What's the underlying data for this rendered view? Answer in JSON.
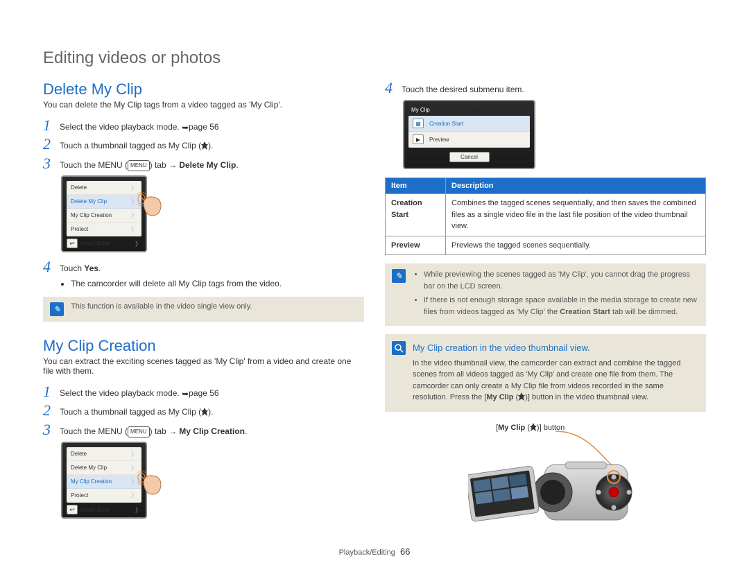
{
  "page_title": "Editing videos or photos",
  "left": {
    "delete": {
      "heading": "Delete My Clip",
      "intro": "You can delete the My Clip tags from a video tagged as 'My Clip'.",
      "steps": {
        "s1": "Select the video playback mode. ",
        "s1_ref": "page 56",
        "s2_pre": "Touch a thumbnail tagged as My Clip (",
        "s2_post": ").",
        "s3_pre": "Touch the MENU (",
        "s3_mid": ") tab → ",
        "s3_bold": "Delete My Clip",
        "s3_post": ".",
        "s4_pre": "Touch ",
        "s4_bold": "Yes",
        "s4_post": ".",
        "s4_sub": "The camcorder will delete all My Clip tags from the video."
      },
      "menu_badge": "MENU",
      "screenshot": {
        "items": [
          "Delete",
          "Delete My Clip",
          "My Clip Creation",
          "Protect",
          "Smart BGM"
        ],
        "highlight_index": 1
      },
      "note": "This function is available in the video single view only."
    },
    "creation": {
      "heading": "My Clip Creation",
      "intro": "You can extract the exciting scenes tagged as 'My Clip' from a video and create one file with them.",
      "steps": {
        "s1": "Select the video playback mode. ",
        "s1_ref": "page 56",
        "s2_pre": "Touch a thumbnail tagged as My Clip (",
        "s2_post": ").",
        "s3_pre": "Touch the MENU (",
        "s3_mid": ") tab → ",
        "s3_bold": "My Clip Creation",
        "s3_post": "."
      },
      "screenshot": {
        "items": [
          "Delete",
          "Delete My Clip",
          "My Clip Creation",
          "Protect",
          "Smart BGM"
        ],
        "highlight_index": 2
      }
    }
  },
  "right": {
    "step4": "Touch the desired submenu item.",
    "submenu": {
      "title": "My Clip",
      "row1": "Creation Start",
      "row2": "Preview",
      "cancel": "Cancel"
    },
    "table": {
      "h_item": "Item",
      "h_desc": "Description",
      "r1_item": "Creation Start",
      "r1_desc": "Combines the tagged scenes sequentially, and then saves the combined files as a single video file in the last file position of the video thumbnail view.",
      "r2_item": "Preview",
      "r2_desc": "Previews the tagged scenes sequentially."
    },
    "note": {
      "b1": "While previewing the scenes tagged as 'My Clip', you cannot drag the progress bar on the LCD screen.",
      "b2_pre": "If there is not enough storage space available in the media storage to create new files from videos tagged as 'My Clip' the ",
      "b2_bold": "Creation Start",
      "b2_post": " tab will be dimmed."
    },
    "info": {
      "title": "My Clip creation in the video thumbnail view.",
      "body_pre": "In the video thumbnail view, the camcorder can extract and combine the tagged scenes from all videos tagged as 'My Clip' and create one file from them. The camcorder can only create a My Clip file from videos recorded in the same resolution. Press the [",
      "body_bold": "My Clip",
      "body_mid": " (",
      "body_post": ")] button in the video thumbnail view."
    },
    "callout_pre": "[",
    "callout_bold": "My Clip",
    "callout_mid": " (",
    "callout_post": ")] button"
  },
  "footer": {
    "section": "Playback/Editing",
    "page": "66"
  }
}
